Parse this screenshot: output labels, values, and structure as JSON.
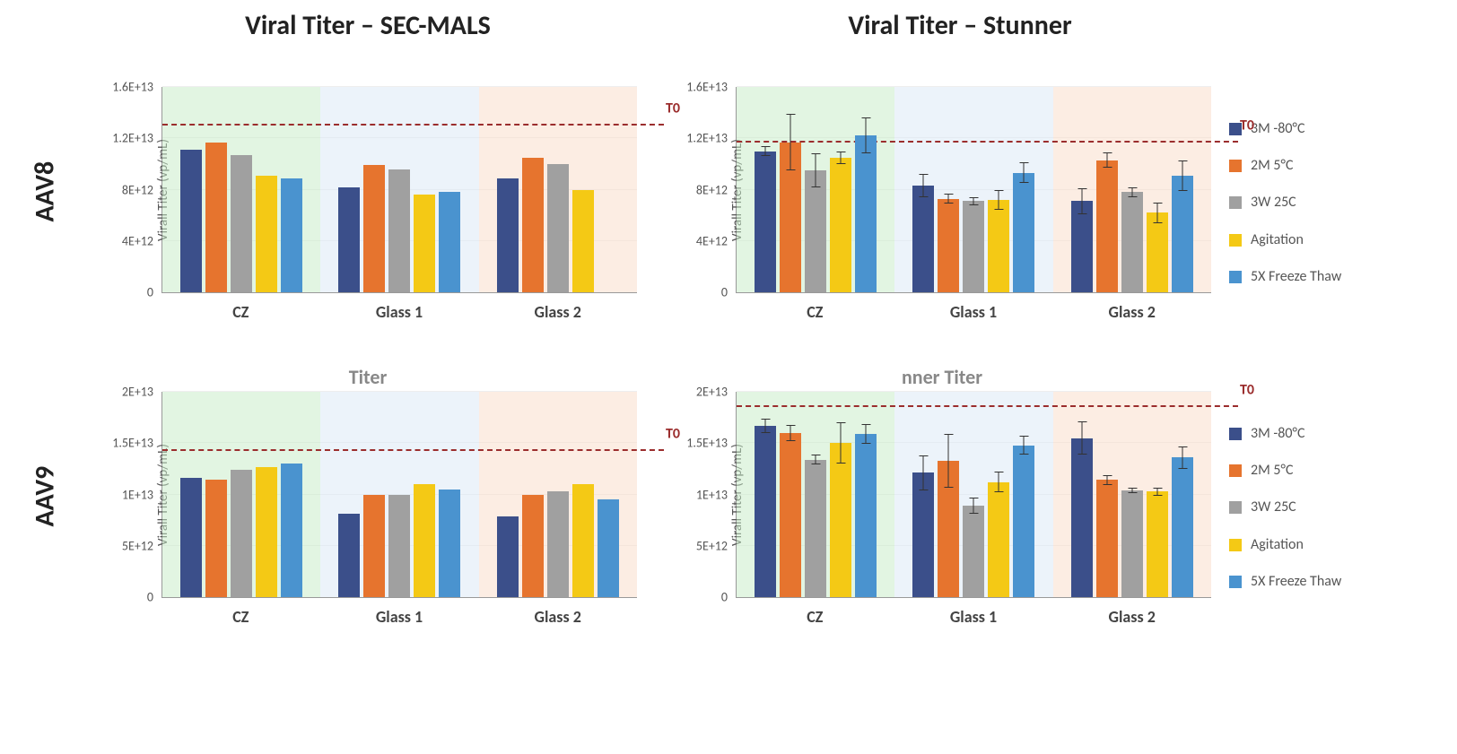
{
  "col_titles": [
    "Viral Titer – SEC-MALS",
    "Viral Titer – Stunner"
  ],
  "row_labels": [
    "AAV8",
    "AAV9"
  ],
  "legend": [
    {
      "label": "3M -80°C",
      "color": "#3b4f8a"
    },
    {
      "label": "2M 5°C",
      "color": "#e6742e"
    },
    {
      "label": "3W 25C",
      "color": "#a0a0a0"
    },
    {
      "label": "Agitation",
      "color": "#f4c915"
    },
    {
      "label": "5X Freeze Thaw",
      "color": "#4a93cf"
    }
  ],
  "x_groups": [
    "CZ",
    "Glass 1",
    "Glass 2"
  ],
  "zone_colors": {
    "CZ": "#c5ecc5",
    "Glass 1": "#d9e7f5",
    "Glass 2": "#f9dbc7"
  },
  "ylabel": "Virall Titer (vp/mL)",
  "t0_label": "T0",
  "sub_titles": {
    "row1_left": "Titer",
    "row1_right": "nner Titer"
  },
  "chart_data": [
    {
      "id": "aav8_sec",
      "row": "AAV8",
      "method": "SEC-MALS",
      "subtitle": "",
      "type": "bar",
      "ylabel": "Virall Titer (vp/mL)",
      "ylim": [
        0,
        16000000000000.0
      ],
      "yticks": [
        0,
        4000000000000.0,
        8000000000000.0,
        12000000000000.0,
        16000000000000.0
      ],
      "ytick_labels": [
        "0",
        "4E+12",
        "8E+12",
        "1.2E+13",
        "1.6E+13"
      ],
      "t0": 13000000000000.0,
      "categories": [
        "CZ",
        "Glass 1",
        "Glass 2"
      ],
      "series": [
        {
          "name": "3M -80°C",
          "values": [
            11100000000000.0,
            8200000000000.0,
            8900000000000.0
          ]
        },
        {
          "name": "2M 5°C",
          "values": [
            11700000000000.0,
            9900000000000.0,
            10500000000000.0
          ]
        },
        {
          "name": "3W 25C",
          "values": [
            10700000000000.0,
            9600000000000.0,
            10000000000000.0
          ]
        },
        {
          "name": "Agitation",
          "values": [
            9100000000000.0,
            7600000000000.0,
            8000000000000.0
          ]
        },
        {
          "name": "5X Freeze Thaw",
          "values": [
            8900000000000.0,
            7800000000000.0,
            null
          ]
        }
      ],
      "errors": null
    },
    {
      "id": "aav8_stunner",
      "row": "AAV8",
      "method": "Stunner",
      "subtitle": "",
      "type": "bar",
      "ylabel": "Virall Titer (vp/mL)",
      "ylim": [
        0,
        16000000000000.0
      ],
      "yticks": [
        0,
        4000000000000.0,
        8000000000000.0,
        12000000000000.0,
        16000000000000.0
      ],
      "ytick_labels": [
        "0",
        "4E+12",
        "8E+12",
        "1.2E+13",
        "1.6E+13"
      ],
      "t0": 11700000000000.0,
      "categories": [
        "CZ",
        "Glass 1",
        "Glass 2"
      ],
      "series": [
        {
          "name": "3M -80°C",
          "values": [
            11000000000000.0,
            8300000000000.0,
            7100000000000.0
          ]
        },
        {
          "name": "2M 5°C",
          "values": [
            11700000000000.0,
            7300000000000.0,
            10300000000000.0
          ]
        },
        {
          "name": "3W 25C",
          "values": [
            9500000000000.0,
            7100000000000.0,
            7800000000000.0
          ]
        },
        {
          "name": "Agitation",
          "values": [
            10500000000000.0,
            7200000000000.0,
            6200000000000.0
          ]
        },
        {
          "name": "5X Freeze Thaw",
          "values": [
            12200000000000.0,
            9300000000000.0,
            9100000000000.0
          ]
        }
      ],
      "errors": [
        {
          "name": "3M -80°C",
          "values": [
            400000000000.0,
            900000000000.0,
            1000000000000.0
          ]
        },
        {
          "name": "2M 5°C",
          "values": [
            2200000000000.0,
            400000000000.0,
            600000000000.0
          ]
        },
        {
          "name": "3W 25C",
          "values": [
            1300000000000.0,
            300000000000.0,
            400000000000.0
          ]
        },
        {
          "name": "Agitation",
          "values": [
            500000000000.0,
            800000000000.0,
            800000000000.0
          ]
        },
        {
          "name": "5X Freeze Thaw",
          "values": [
            1400000000000.0,
            800000000000.0,
            1200000000000.0
          ]
        }
      ]
    },
    {
      "id": "aav9_sec",
      "row": "AAV9",
      "method": "SEC-MALS",
      "subtitle": "Titer",
      "type": "bar",
      "ylabel": "Virall Titer (vp/mL)",
      "ylim": [
        0,
        20000000000000.0
      ],
      "yticks": [
        0,
        5000000000000.0,
        10000000000000.0,
        15000000000000.0,
        20000000000000.0
      ],
      "ytick_labels": [
        "0",
        "5E+12",
        "1E+13",
        "1.5E+13",
        "2E+13"
      ],
      "t0": 14200000000000.0,
      "categories": [
        "CZ",
        "Glass 1",
        "Glass 2"
      ],
      "series": [
        {
          "name": "3M -80°C",
          "values": [
            11600000000000.0,
            8100000000000.0,
            7900000000000.0
          ]
        },
        {
          "name": "2M 5°C",
          "values": [
            11400000000000.0,
            10000000000000.0,
            10000000000000.0
          ]
        },
        {
          "name": "3W 25C",
          "values": [
            12400000000000.0,
            10000000000000.0,
            10300000000000.0
          ]
        },
        {
          "name": "Agitation",
          "values": [
            12700000000000.0,
            11000000000000.0,
            11000000000000.0
          ]
        },
        {
          "name": "5X Freeze Thaw",
          "values": [
            13000000000000.0,
            10500000000000.0,
            9500000000000.0
          ]
        }
      ],
      "errors": null
    },
    {
      "id": "aav9_stunner",
      "row": "AAV9",
      "method": "Stunner",
      "subtitle": "nner Titer",
      "type": "bar",
      "ylabel": "Virall Titer (vp/mL)",
      "ylim": [
        0,
        20000000000000.0
      ],
      "yticks": [
        0,
        5000000000000.0,
        10000000000000.0,
        15000000000000.0,
        20000000000000.0
      ],
      "ytick_labels": [
        "0",
        "5E+12",
        "1E+13",
        "1.5E+13",
        "2E+13"
      ],
      "t0": 18500000000000.0,
      "categories": [
        "CZ",
        "Glass 1",
        "Glass 2"
      ],
      "series": [
        {
          "name": "3M -80°C",
          "values": [
            16700000000000.0,
            12100000000000.0,
            15500000000000.0
          ]
        },
        {
          "name": "2M 5°C",
          "values": [
            16000000000000.0,
            13300000000000.0,
            11400000000000.0
          ]
        },
        {
          "name": "3W 25C",
          "values": [
            13400000000000.0,
            8900000000000.0,
            10400000000000.0
          ]
        },
        {
          "name": "Agitation",
          "values": [
            15000000000000.0,
            11200000000000.0,
            10300000000000.0
          ]
        },
        {
          "name": "5X Freeze Thaw",
          "values": [
            15900000000000.0,
            14800000000000.0,
            13600000000000.0
          ]
        }
      ],
      "errors": [
        {
          "name": "3M -80°C",
          "values": [
            700000000000.0,
            1700000000000.0,
            1600000000000.0
          ]
        },
        {
          "name": "2M 5°C",
          "values": [
            800000000000.0,
            2600000000000.0,
            500000000000.0
          ]
        },
        {
          "name": "3W 25C",
          "values": [
            500000000000.0,
            800000000000.0,
            300000000000.0
          ]
        },
        {
          "name": "Agitation",
          "values": [
            2000000000000.0,
            1000000000000.0,
            400000000000.0
          ]
        },
        {
          "name": "5X Freeze Thaw",
          "values": [
            1000000000000.0,
            900000000000.0,
            1100000000000.0
          ]
        }
      ]
    }
  ]
}
